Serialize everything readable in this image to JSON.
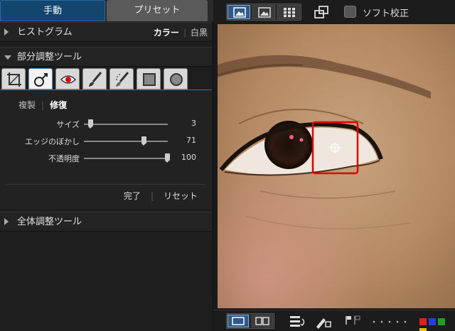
{
  "tabs": {
    "manual": "手動",
    "preset": "プリセット"
  },
  "histogram": {
    "label": "ヒストグラム",
    "opt_color": "カラー",
    "opt_wb": "白黒"
  },
  "partial_tools": {
    "label": "部分調整ツール"
  },
  "tools": [
    {
      "name": "crop-tool-icon",
      "selected": false
    },
    {
      "name": "heal-tool-icon",
      "selected": true
    },
    {
      "name": "red-eye-tool-icon",
      "selected": false
    },
    {
      "name": "brush-tool-icon",
      "selected": false
    },
    {
      "name": "eraser-brush-tool-icon",
      "selected": false
    },
    {
      "name": "rectangle-mask-tool-icon",
      "selected": false
    },
    {
      "name": "circle-mask-tool-icon",
      "selected": false
    }
  ],
  "modes": {
    "clone": "複製",
    "repair": "修復"
  },
  "sliders": [
    {
      "label": "サイズ",
      "value": "3",
      "fraction": 0.05
    },
    {
      "label": "エッジのぼかし",
      "value": "71",
      "fraction": 0.71
    },
    {
      "label": "不透明度",
      "value": "100",
      "fraction": 1.0
    }
  ],
  "actions": {
    "done": "完了",
    "reset": "リセット"
  },
  "global_tools": {
    "label": "全体調整ツール"
  },
  "toolbar": {
    "soft_proof": "ソフト校正"
  },
  "colors": {
    "accent": "#2d5a86",
    "marker_red": "#e00000"
  },
  "color_labels": [
    "#e02020",
    "#2040e0",
    "#20a020",
    "#e0c020"
  ]
}
